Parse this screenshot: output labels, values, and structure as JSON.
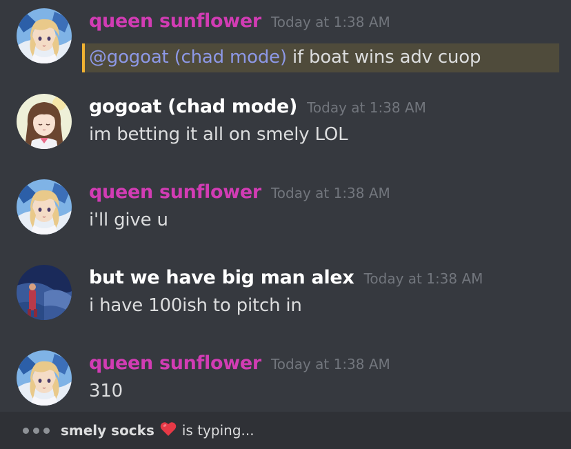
{
  "colors": {
    "background": "#36393f",
    "typing_bar": "#2f3136",
    "role_pink": "#d23cb4",
    "role_white": "#ffffff",
    "timestamp": "#72767d",
    "text": "#dcddde",
    "mention": "#8d98e6",
    "mention_bar": "#f0b232",
    "heart": "#e63946"
  },
  "messages": [
    {
      "author": "queen sunflower",
      "author_color": "#d23cb4",
      "avatar_icon": "anime-girl-blonde-avatar",
      "timestamp": "Today at 1:38 AM",
      "mention": "@gogoat (chad mode)",
      "text": " if boat wins adv cuop"
    },
    {
      "author": "gogoat (chad mode)",
      "author_color": "#ffffff",
      "avatar_icon": "anime-girl-brunette-avatar",
      "timestamp": "Today at 1:38 AM",
      "text": "im betting it all on smely LOL"
    },
    {
      "author": "queen sunflower",
      "author_color": "#d23cb4",
      "avatar_icon": "anime-girl-blonde-avatar",
      "timestamp": "Today at 1:38 AM",
      "text": "i'll give u"
    },
    {
      "author": "but we have big man alex",
      "author_color": "#ffffff",
      "avatar_icon": "night-scene-avatar",
      "timestamp": "Today at 1:38 AM",
      "text": "i have 100ish to pitch in"
    },
    {
      "author": "queen sunflower",
      "author_color": "#d23cb4",
      "avatar_icon": "anime-girl-blonde-avatar",
      "timestamp": "Today at 1:38 AM",
      "text": "310"
    }
  ],
  "typing": {
    "user": "smely socks",
    "emoji": "❤️",
    "suffix": "is typing..."
  }
}
